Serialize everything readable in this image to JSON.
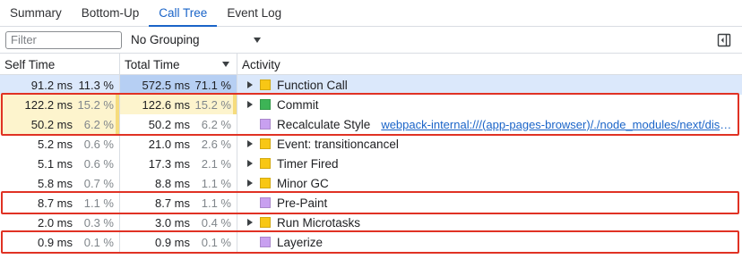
{
  "tabs": [
    {
      "label": "Summary",
      "active": false
    },
    {
      "label": "Bottom-Up",
      "active": false
    },
    {
      "label": "Call Tree",
      "active": true
    },
    {
      "label": "Event Log",
      "active": false
    }
  ],
  "toolbar": {
    "filter_placeholder": "Filter",
    "filter_value": "",
    "grouping_label": "No Grouping"
  },
  "columns": {
    "self_time": "Self Time",
    "total_time": "Total Time",
    "activity": "Activity",
    "sorted_by": "Total Time",
    "sort_direction": "descending"
  },
  "colors": {
    "scripting": "#f8c715",
    "rendering": "#c8a0f0",
    "painting": "#3db456",
    "highlight_box": "#e03224",
    "selection": "#dbe8fb"
  },
  "rows": [
    {
      "self_ms": "91.2 ms",
      "self_pct": "11.3 %",
      "total_ms": "572.5 ms",
      "total_pct": "71.1 %",
      "activity": "Function Call",
      "swatch": "#f8c715",
      "expandable": true,
      "selected": true,
      "self_highlight": false,
      "total_highlight": false,
      "link": ""
    },
    {
      "self_ms": "122.2 ms",
      "self_pct": "15.2 %",
      "total_ms": "122.6 ms",
      "total_pct": "15.2 %",
      "activity": "Commit",
      "swatch": "#3db456",
      "expandable": true,
      "selected": false,
      "self_highlight": true,
      "total_highlight": true,
      "link": ""
    },
    {
      "self_ms": "50.2 ms",
      "self_pct": "6.2 %",
      "total_ms": "50.2 ms",
      "total_pct": "6.2 %",
      "activity": "Recalculate Style",
      "swatch": "#c8a0f0",
      "expandable": false,
      "selected": false,
      "self_highlight": true,
      "total_highlight": false,
      "link": "webpack-internal:///(app-pages-browser)/./node_modules/next/dist/client/components/app-router.js"
    },
    {
      "self_ms": "5.2 ms",
      "self_pct": "0.6 %",
      "total_ms": "21.0 ms",
      "total_pct": "2.6 %",
      "activity": "Event: transitioncancel",
      "swatch": "#f8c715",
      "expandable": true,
      "selected": false,
      "self_highlight": false,
      "total_highlight": false,
      "link": ""
    },
    {
      "self_ms": "5.1 ms",
      "self_pct": "0.6 %",
      "total_ms": "17.3 ms",
      "total_pct": "2.1 %",
      "activity": "Timer Fired",
      "swatch": "#f8c715",
      "expandable": true,
      "selected": false,
      "self_highlight": false,
      "total_highlight": false,
      "link": ""
    },
    {
      "self_ms": "5.8 ms",
      "self_pct": "0.7 %",
      "total_ms": "8.8 ms",
      "total_pct": "1.1 %",
      "activity": "Minor GC",
      "swatch": "#f8c715",
      "expandable": true,
      "selected": false,
      "self_highlight": false,
      "total_highlight": false,
      "link": ""
    },
    {
      "self_ms": "8.7 ms",
      "self_pct": "1.1 %",
      "total_ms": "8.7 ms",
      "total_pct": "1.1 %",
      "activity": "Pre-Paint",
      "swatch": "#c8a0f0",
      "expandable": false,
      "selected": false,
      "self_highlight": false,
      "total_highlight": false,
      "link": ""
    },
    {
      "self_ms": "2.0 ms",
      "self_pct": "0.3 %",
      "total_ms": "3.0 ms",
      "total_pct": "0.4 %",
      "activity": "Run Microtasks",
      "swatch": "#f8c715",
      "expandable": true,
      "selected": false,
      "self_highlight": false,
      "total_highlight": false,
      "link": ""
    },
    {
      "self_ms": "0.9 ms",
      "self_pct": "0.1 %",
      "total_ms": "0.9 ms",
      "total_pct": "0.1 %",
      "activity": "Layerize",
      "swatch": "#c8a0f0",
      "expandable": false,
      "selected": false,
      "self_highlight": false,
      "total_highlight": false,
      "link": ""
    }
  ],
  "annotations": [
    {
      "label": "highlight-commit-recalc",
      "first_row": 1,
      "last_row": 2
    },
    {
      "label": "highlight-pre-paint",
      "first_row": 6,
      "last_row": 6
    },
    {
      "label": "highlight-layerize",
      "first_row": 8,
      "last_row": 8
    }
  ]
}
